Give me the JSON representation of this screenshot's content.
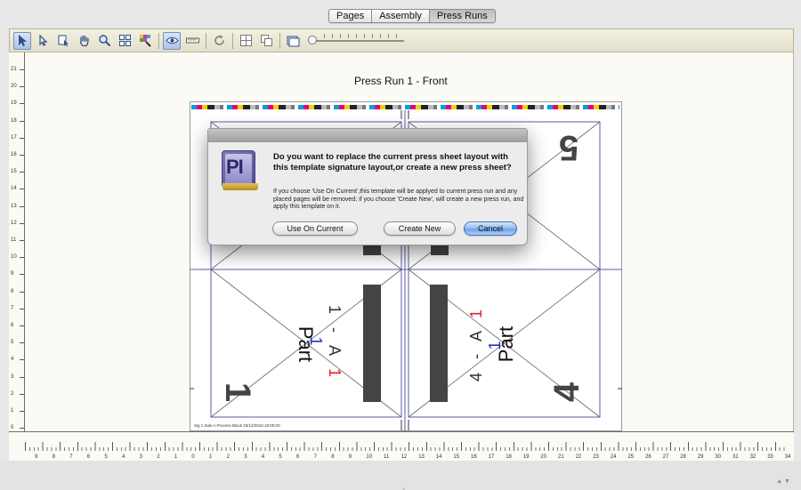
{
  "tabs": [
    {
      "label": "Pages",
      "active": false
    },
    {
      "label": "Assembly",
      "active": false
    },
    {
      "label": "Press Runs",
      "active": true
    }
  ],
  "toolbar": {
    "tools": [
      "select-arrow-icon",
      "direct-select-icon",
      "page-select-icon",
      "hand-icon",
      "zoom-icon",
      "grid-icon",
      "color-picker-icon",
      "eye-icon",
      "ruler-icon",
      "rotate-icon",
      "layout-icon",
      "layout-alt-icon",
      "sheet-icon"
    ],
    "zoom_slider_value": 0
  },
  "canvas": {
    "title": "Press Run 1 - Front",
    "footnote": "Sig 1 Side A Process Black 03/12/2018 18:00:00",
    "vertical_ruler": [
      "21",
      "20",
      "19",
      "18",
      "17",
      "16",
      "15",
      "14",
      "13",
      "12",
      "11",
      "10",
      "9",
      "8",
      "7",
      "6",
      "5",
      "4",
      "3",
      "2",
      "1",
      "0",
      "1"
    ],
    "horizontal_ruler": [
      "9",
      "8",
      "7",
      "6",
      "5",
      "4",
      "3",
      "2",
      "1",
      "0",
      "1",
      "2",
      "3",
      "4",
      "5",
      "6",
      "7",
      "8",
      "9",
      "10",
      "11",
      "12",
      "13",
      "14",
      "15",
      "16",
      "17",
      "18",
      "19",
      "20",
      "21",
      "22",
      "23",
      "24",
      "25",
      "26",
      "27",
      "28",
      "29",
      "30",
      "31",
      "32",
      "33",
      "34"
    ],
    "pages": {
      "top_right_number": "5",
      "bottom_left_number": "1",
      "bottom_right_number": "4",
      "left_part_text": "Part",
      "right_part_text": "Part",
      "left_part_code": [
        "1",
        "-",
        "A",
        "1",
        "1"
      ],
      "right_part_code": [
        "4",
        "-",
        "A",
        "1",
        "1"
      ]
    }
  },
  "dialog": {
    "title": "Do you want to replace the current press sheet layout with this template signature layout,or create a new press sheet?",
    "body": "If you choose 'Use On Current',this template will be applyed to current press run and any placed pages will be removed; if you choose 'Create New', will create a new press run, and apply this template on it.",
    "icon_text": "PI",
    "buttons": {
      "use_current": "Use On Current",
      "create_new": "Create New",
      "cancel": "Cancel"
    }
  },
  "colors": {
    "accent": "#6aa1e6",
    "frame_lines": "#5a5aa8",
    "bleed_block": "#444444",
    "code_red": "#e0202a",
    "code_blue": "#2030c8"
  }
}
